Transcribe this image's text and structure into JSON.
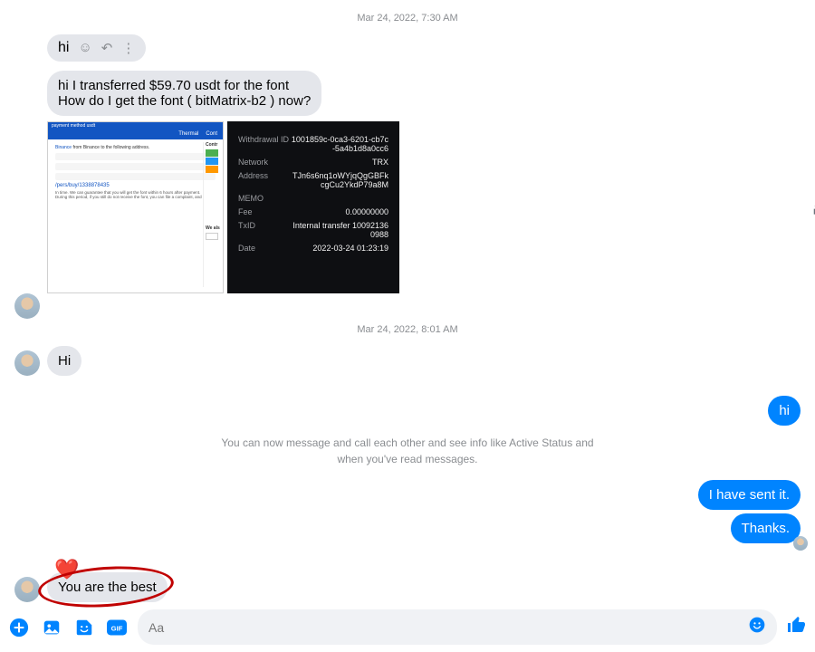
{
  "timestamps": {
    "t1": "Mar 24, 2022, 7:30 AM",
    "t2": "Mar 24, 2022, 8:01 AM"
  },
  "messages": {
    "hi_pill": "hi",
    "transfer_line1": "hi I transferred $59.70 usdt for the font",
    "transfer_line2": "How do I get the font ( bitMatrix-b2 )  now?",
    "hi2": "Hi",
    "hi3_right": "hi",
    "sent": "I have sent it.",
    "thanks": "Thanks.",
    "best": "You are the best"
  },
  "system_info": "You can now message and call each other and see info like Active Status and when you've read messages.",
  "composer": {
    "placeholder": "Aa"
  },
  "receipt": {
    "withdrawal_id_label": "Withdrawal ID",
    "withdrawal_id": "1001859c-0ca3-6201-cb7c-5a4b1d8a0cc6",
    "network_label": "Network",
    "network": "TRX",
    "address_label": "Address",
    "address": "TJn6s6nq1oWYjqQgGBFkcgCu2YkdP79a8M",
    "memo_label": "MEMO",
    "memo": "",
    "fee_label": "Fee",
    "fee": "0.00000000",
    "txid_label": "TxID",
    "txid": "Internal transfer 100921360988",
    "date_label": "Date",
    "date": "2022-03-24 01:23:19"
  },
  "shot1": {
    "tab1": "Thermal",
    "tab2": "Cont",
    "side_label": "Contr",
    "also": "We als",
    "link_small": "/pers/buy/1338878435",
    "addr_note": "from Binance to the following address.",
    "note1": "In time. We can guarantee that you will get the font within 6 hours after payment.",
    "note2": "During this period, if you still do not receive the font, you can file a complaint, and"
  }
}
